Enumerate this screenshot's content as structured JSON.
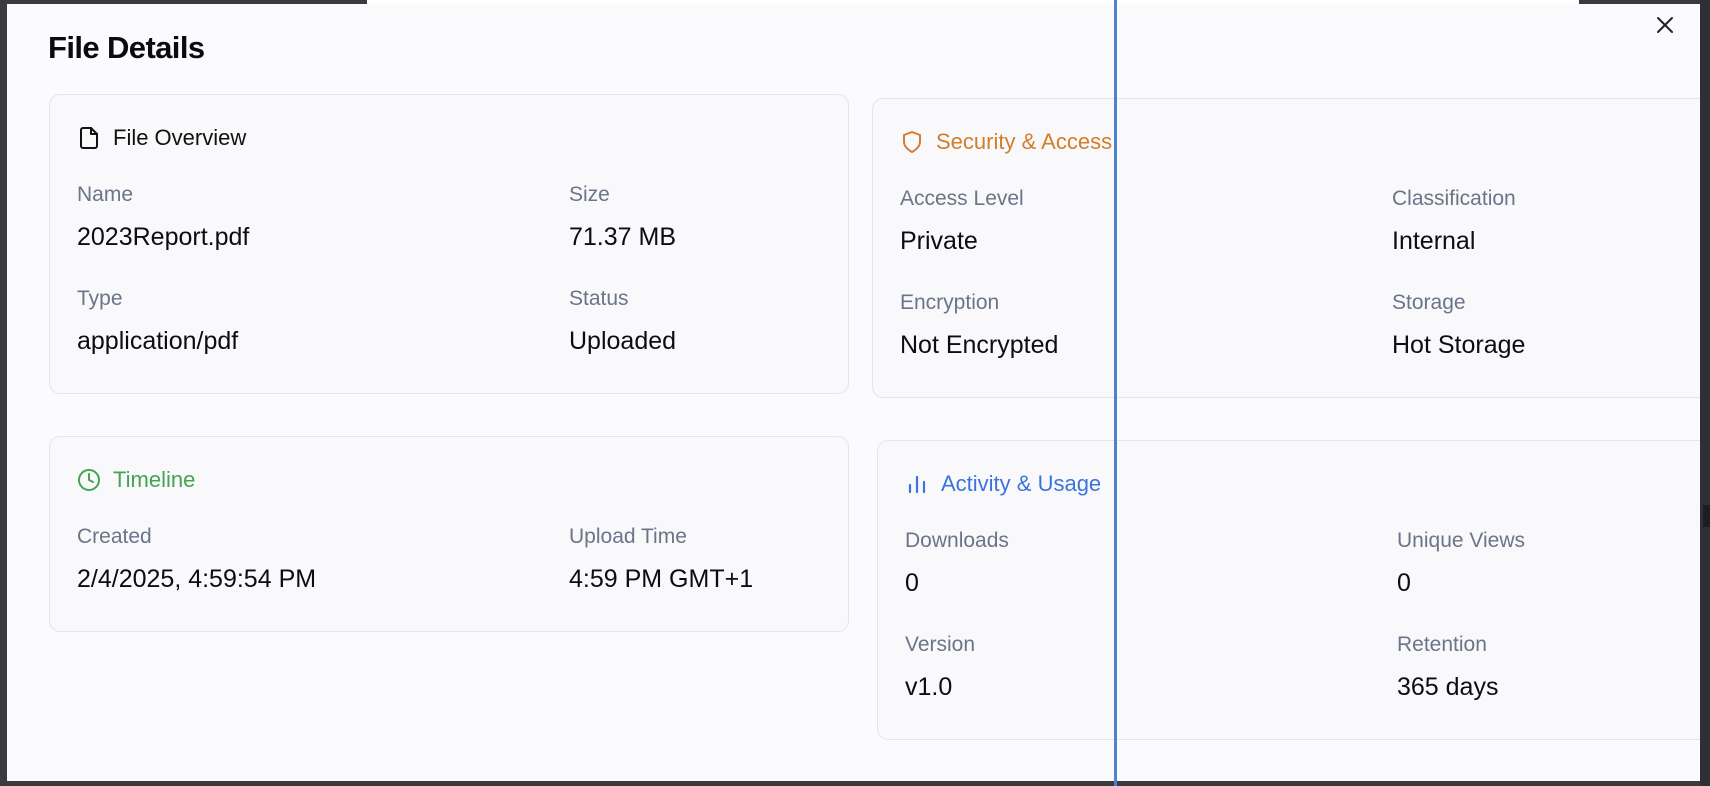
{
  "dialog": {
    "title": "File Details",
    "close_icon": "close-icon"
  },
  "overview": {
    "title": "File Overview",
    "icon": "file-icon",
    "accent": "#111111",
    "fields": [
      {
        "label": "Name",
        "value": "2023Report.pdf"
      },
      {
        "label": "Size",
        "value": "71.37 MB"
      },
      {
        "label": "Type",
        "value": "application/pdf"
      },
      {
        "label": "Status",
        "value": "Uploaded"
      }
    ]
  },
  "timeline": {
    "title": "Timeline",
    "icon": "clock-icon",
    "accent": "#43a452",
    "fields": [
      {
        "label": "Created",
        "value": "2/4/2025, 4:59:54 PM"
      },
      {
        "label": "Upload Time",
        "value": "4:59 PM GMT+1"
      }
    ]
  },
  "security": {
    "title": "Security & Access",
    "icon": "shield-icon",
    "accent": "#d47d2a",
    "fields": [
      {
        "label": "Access Level",
        "value": "Private"
      },
      {
        "label": "Classification",
        "value": "Internal"
      },
      {
        "label": "Encryption",
        "value": "Not Encrypted"
      },
      {
        "label": "Storage",
        "value": "Hot Storage"
      }
    ]
  },
  "activity": {
    "title": "Activity & Usage",
    "icon": "bar-chart-icon",
    "accent": "#3d73dc",
    "fields": [
      {
        "label": "Downloads",
        "value": "0"
      },
      {
        "label": "Unique Views",
        "value": "0"
      },
      {
        "label": "Version",
        "value": "v1.0"
      },
      {
        "label": "Retention",
        "value": "365 days"
      }
    ]
  }
}
